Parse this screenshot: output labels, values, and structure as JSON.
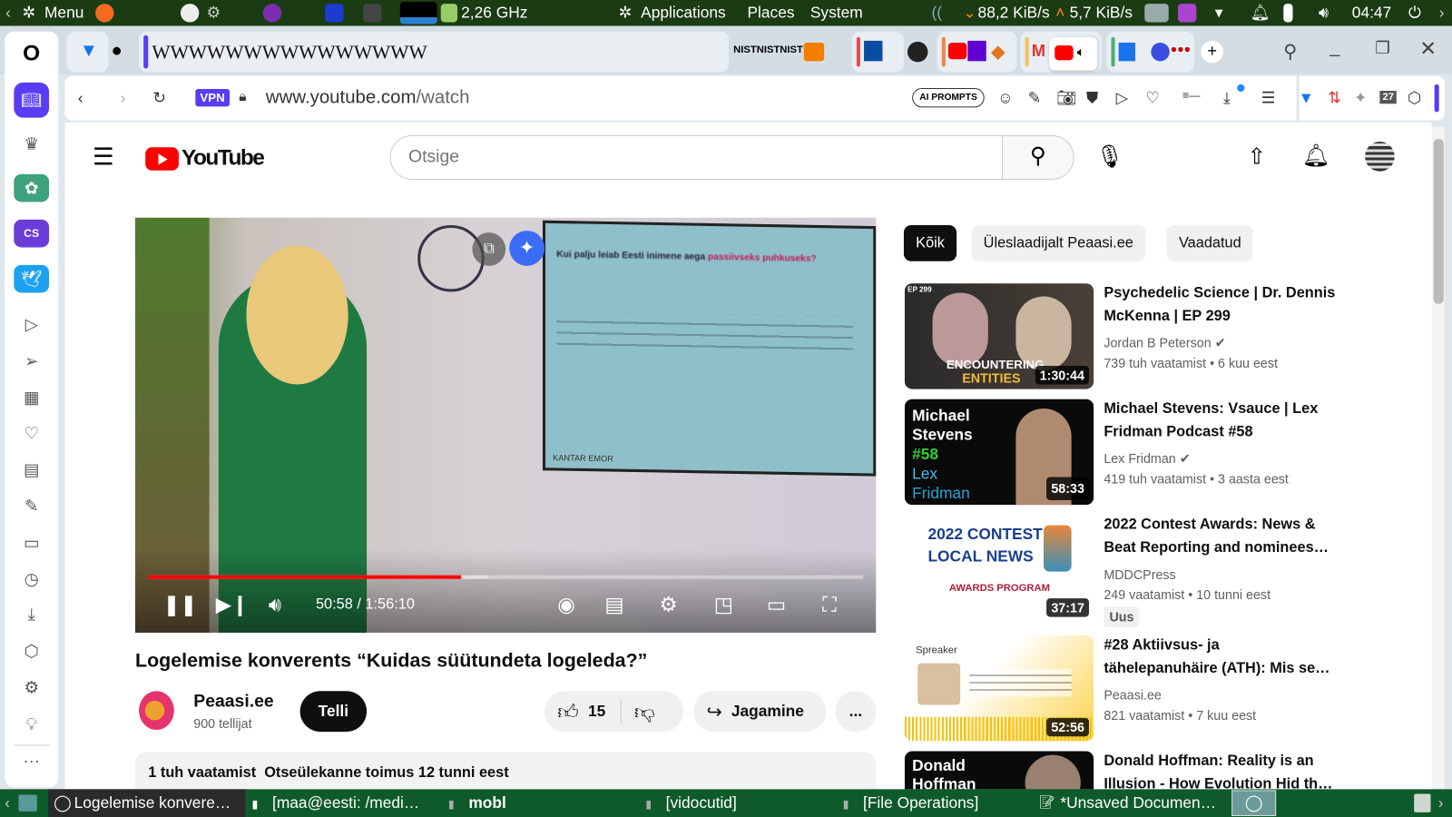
{
  "top_panel": {
    "menu": "Menu",
    "cpu": "2,26 GHz",
    "applications": "Applications",
    "places": "Places",
    "system": "System",
    "net_down": "88,2 KiB/s",
    "net_up": "5,7 KiB/s",
    "clock": "04:47"
  },
  "tabs": {
    "pinned_text": "WWWWWWWWWWWWWWW",
    "nist": "NISTNISTNIST",
    "new_tab": "+"
  },
  "address_bar": {
    "vpn": "VPN",
    "url_host": "www.youtube.com",
    "url_path": "/watch",
    "ai_prompts": "AI PROMPTS",
    "calendar_day": "27"
  },
  "youtube": {
    "logo": "YouTube",
    "search_placeholder": "Otsige",
    "video": {
      "slide_title": "Kui palju leiab Eesti inimene aega ",
      "slide_title_hl": "passiivseks puhkuseks?",
      "slide_footer": "KANTAR EMOR",
      "time": "50:58 / 1:56:10",
      "progress": 0.438
    },
    "title": "Logelemise konverents “Kuidas süütundeta logeleda?”",
    "channel": {
      "name": "Peaasi.ee",
      "subs": "900 tellijat",
      "subscribe": "Telli"
    },
    "likes": "15",
    "share": "Jagamine",
    "more": "...",
    "description": {
      "views": "1 tuh vaatamist",
      "date": "Otseülekanne toimus 12 tunni eest"
    },
    "chips": [
      "Kõik",
      "Üleslaadijalt Peaasi.ee",
      "Vaadatud"
    ],
    "recommendations": [
      {
        "title": "Psychedelic Science | Dr. Dennis McKenna | EP 299",
        "channel": "Jordan B Peterson",
        "verified": true,
        "views": "739 tuh vaatamist",
        "age": "6 kuu eest",
        "duration": "1:30:44",
        "thumb_text": "ENCOUNTERING",
        "thumb_text2": "ENTITIES",
        "thumb_ep": "EP 299"
      },
      {
        "title": "Michael Stevens: Vsauce | Lex Fridman Podcast #58",
        "channel": "Lex Fridman",
        "verified": true,
        "views": "419 tuh vaatamist",
        "age": "3 aasta eest",
        "duration": "58:33",
        "thumb_lines": [
          "Michael",
          "Stevens",
          "#58",
          "Lex",
          "Fridman"
        ]
      },
      {
        "title": "2022 Contest Awards: News & Beat Reporting and nominees…",
        "channel": "MDDCPress",
        "views": "249 vaatamist",
        "age": "10 tunni eest",
        "badge": "Uus",
        "duration": "37:17",
        "thumb_text": "2022 CONTEST",
        "thumb_text2": "LOCAL NEWS",
        "thumb_text3": "AWARDS PROGRAM"
      },
      {
        "title": "#28 Aktiivsus- ja tähelepanuhäire (ATH): Mis se…",
        "channel": "Peaasi.ee",
        "views": "821 vaatamist",
        "age": "7 kuu eest",
        "duration": "52:56",
        "thumb_text": "Spreaker"
      },
      {
        "title": "Donald Hoffman: Reality is an Illusion - How Evolution Hid th…",
        "thumb_lines": [
          "Donald",
          "Hoffman"
        ]
      }
    ]
  },
  "taskbar": [
    "Logelemise konvere…",
    "[maa@eesti: /medi…",
    "mobl",
    "[vidocutid]",
    "[File Operations]",
    "*Unsaved Documen…"
  ],
  "colors": {
    "panel": "#1b3b12",
    "taskbar": "#0e5a2a",
    "yt_red": "#ff0000",
    "accent": "#5b3cf5"
  }
}
